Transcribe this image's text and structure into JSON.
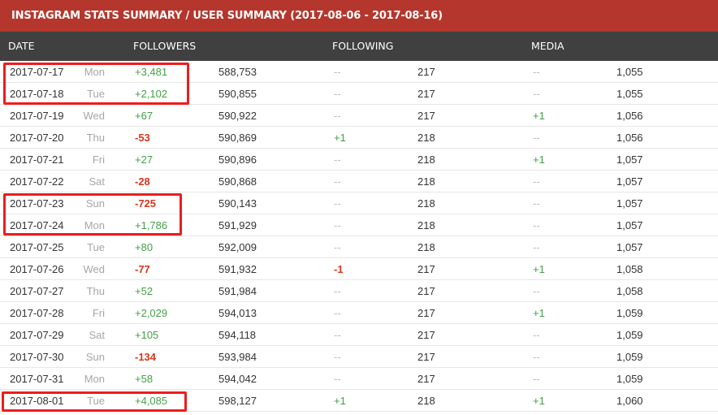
{
  "title": "INSTAGRAM STATS SUMMARY / USER SUMMARY (2017-08-06 - 2017-08-16)",
  "columns": {
    "date": "DATE",
    "followers": "FOLLOWERS",
    "following": "FOLLOWING",
    "media": "MEDIA"
  },
  "colors": {
    "title_bar": "#b5362c",
    "header_row": "#404040",
    "positive": "#43a047",
    "negative": "#d9361c",
    "highlight_box": "#ee1c1c"
  },
  "rows": [
    {
      "date": "2017-07-17",
      "day": "Mon",
      "followers_change": "+3,481",
      "followers": "588,753",
      "following_change": "--",
      "following": "217",
      "media_change": "--",
      "media": "1,055"
    },
    {
      "date": "2017-07-18",
      "day": "Tue",
      "followers_change": "+2,102",
      "followers": "590,855",
      "following_change": "--",
      "following": "217",
      "media_change": "--",
      "media": "1,055"
    },
    {
      "date": "2017-07-19",
      "day": "Wed",
      "followers_change": "+67",
      "followers": "590,922",
      "following_change": "--",
      "following": "217",
      "media_change": "+1",
      "media": "1,056"
    },
    {
      "date": "2017-07-20",
      "day": "Thu",
      "followers_change": "-53",
      "followers": "590,869",
      "following_change": "+1",
      "following": "218",
      "media_change": "--",
      "media": "1,056"
    },
    {
      "date": "2017-07-21",
      "day": "Fri",
      "followers_change": "+27",
      "followers": "590,896",
      "following_change": "--",
      "following": "218",
      "media_change": "+1",
      "media": "1,057"
    },
    {
      "date": "2017-07-22",
      "day": "Sat",
      "followers_change": "-28",
      "followers": "590,868",
      "following_change": "--",
      "following": "218",
      "media_change": "--",
      "media": "1,057"
    },
    {
      "date": "2017-07-23",
      "day": "Sun",
      "followers_change": "-725",
      "followers": "590,143",
      "following_change": "--",
      "following": "218",
      "media_change": "--",
      "media": "1,057"
    },
    {
      "date": "2017-07-24",
      "day": "Mon",
      "followers_change": "+1,786",
      "followers": "591,929",
      "following_change": "--",
      "following": "218",
      "media_change": "--",
      "media": "1,057"
    },
    {
      "date": "2017-07-25",
      "day": "Tue",
      "followers_change": "+80",
      "followers": "592,009",
      "following_change": "--",
      "following": "218",
      "media_change": "--",
      "media": "1,057"
    },
    {
      "date": "2017-07-26",
      "day": "Wed",
      "followers_change": "-77",
      "followers": "591,932",
      "following_change": "-1",
      "following": "217",
      "media_change": "+1",
      "media": "1,058"
    },
    {
      "date": "2017-07-27",
      "day": "Thu",
      "followers_change": "+52",
      "followers": "591,984",
      "following_change": "--",
      "following": "217",
      "media_change": "--",
      "media": "1,058"
    },
    {
      "date": "2017-07-28",
      "day": "Fri",
      "followers_change": "+2,029",
      "followers": "594,013",
      "following_change": "--",
      "following": "217",
      "media_change": "+1",
      "media": "1,059"
    },
    {
      "date": "2017-07-29",
      "day": "Sat",
      "followers_change": "+105",
      "followers": "594,118",
      "following_change": "--",
      "following": "217",
      "media_change": "--",
      "media": "1,059"
    },
    {
      "date": "2017-07-30",
      "day": "Sun",
      "followers_change": "-134",
      "followers": "593,984",
      "following_change": "--",
      "following": "217",
      "media_change": "--",
      "media": "1,059"
    },
    {
      "date": "2017-07-31",
      "day": "Mon",
      "followers_change": "+58",
      "followers": "594,042",
      "following_change": "--",
      "following": "217",
      "media_change": "--",
      "media": "1,059"
    },
    {
      "date": "2017-08-01",
      "day": "Tue",
      "followers_change": "+4,085",
      "followers": "598,127",
      "following_change": "+1",
      "following": "218",
      "media_change": "+1",
      "media": "1,060"
    }
  ]
}
